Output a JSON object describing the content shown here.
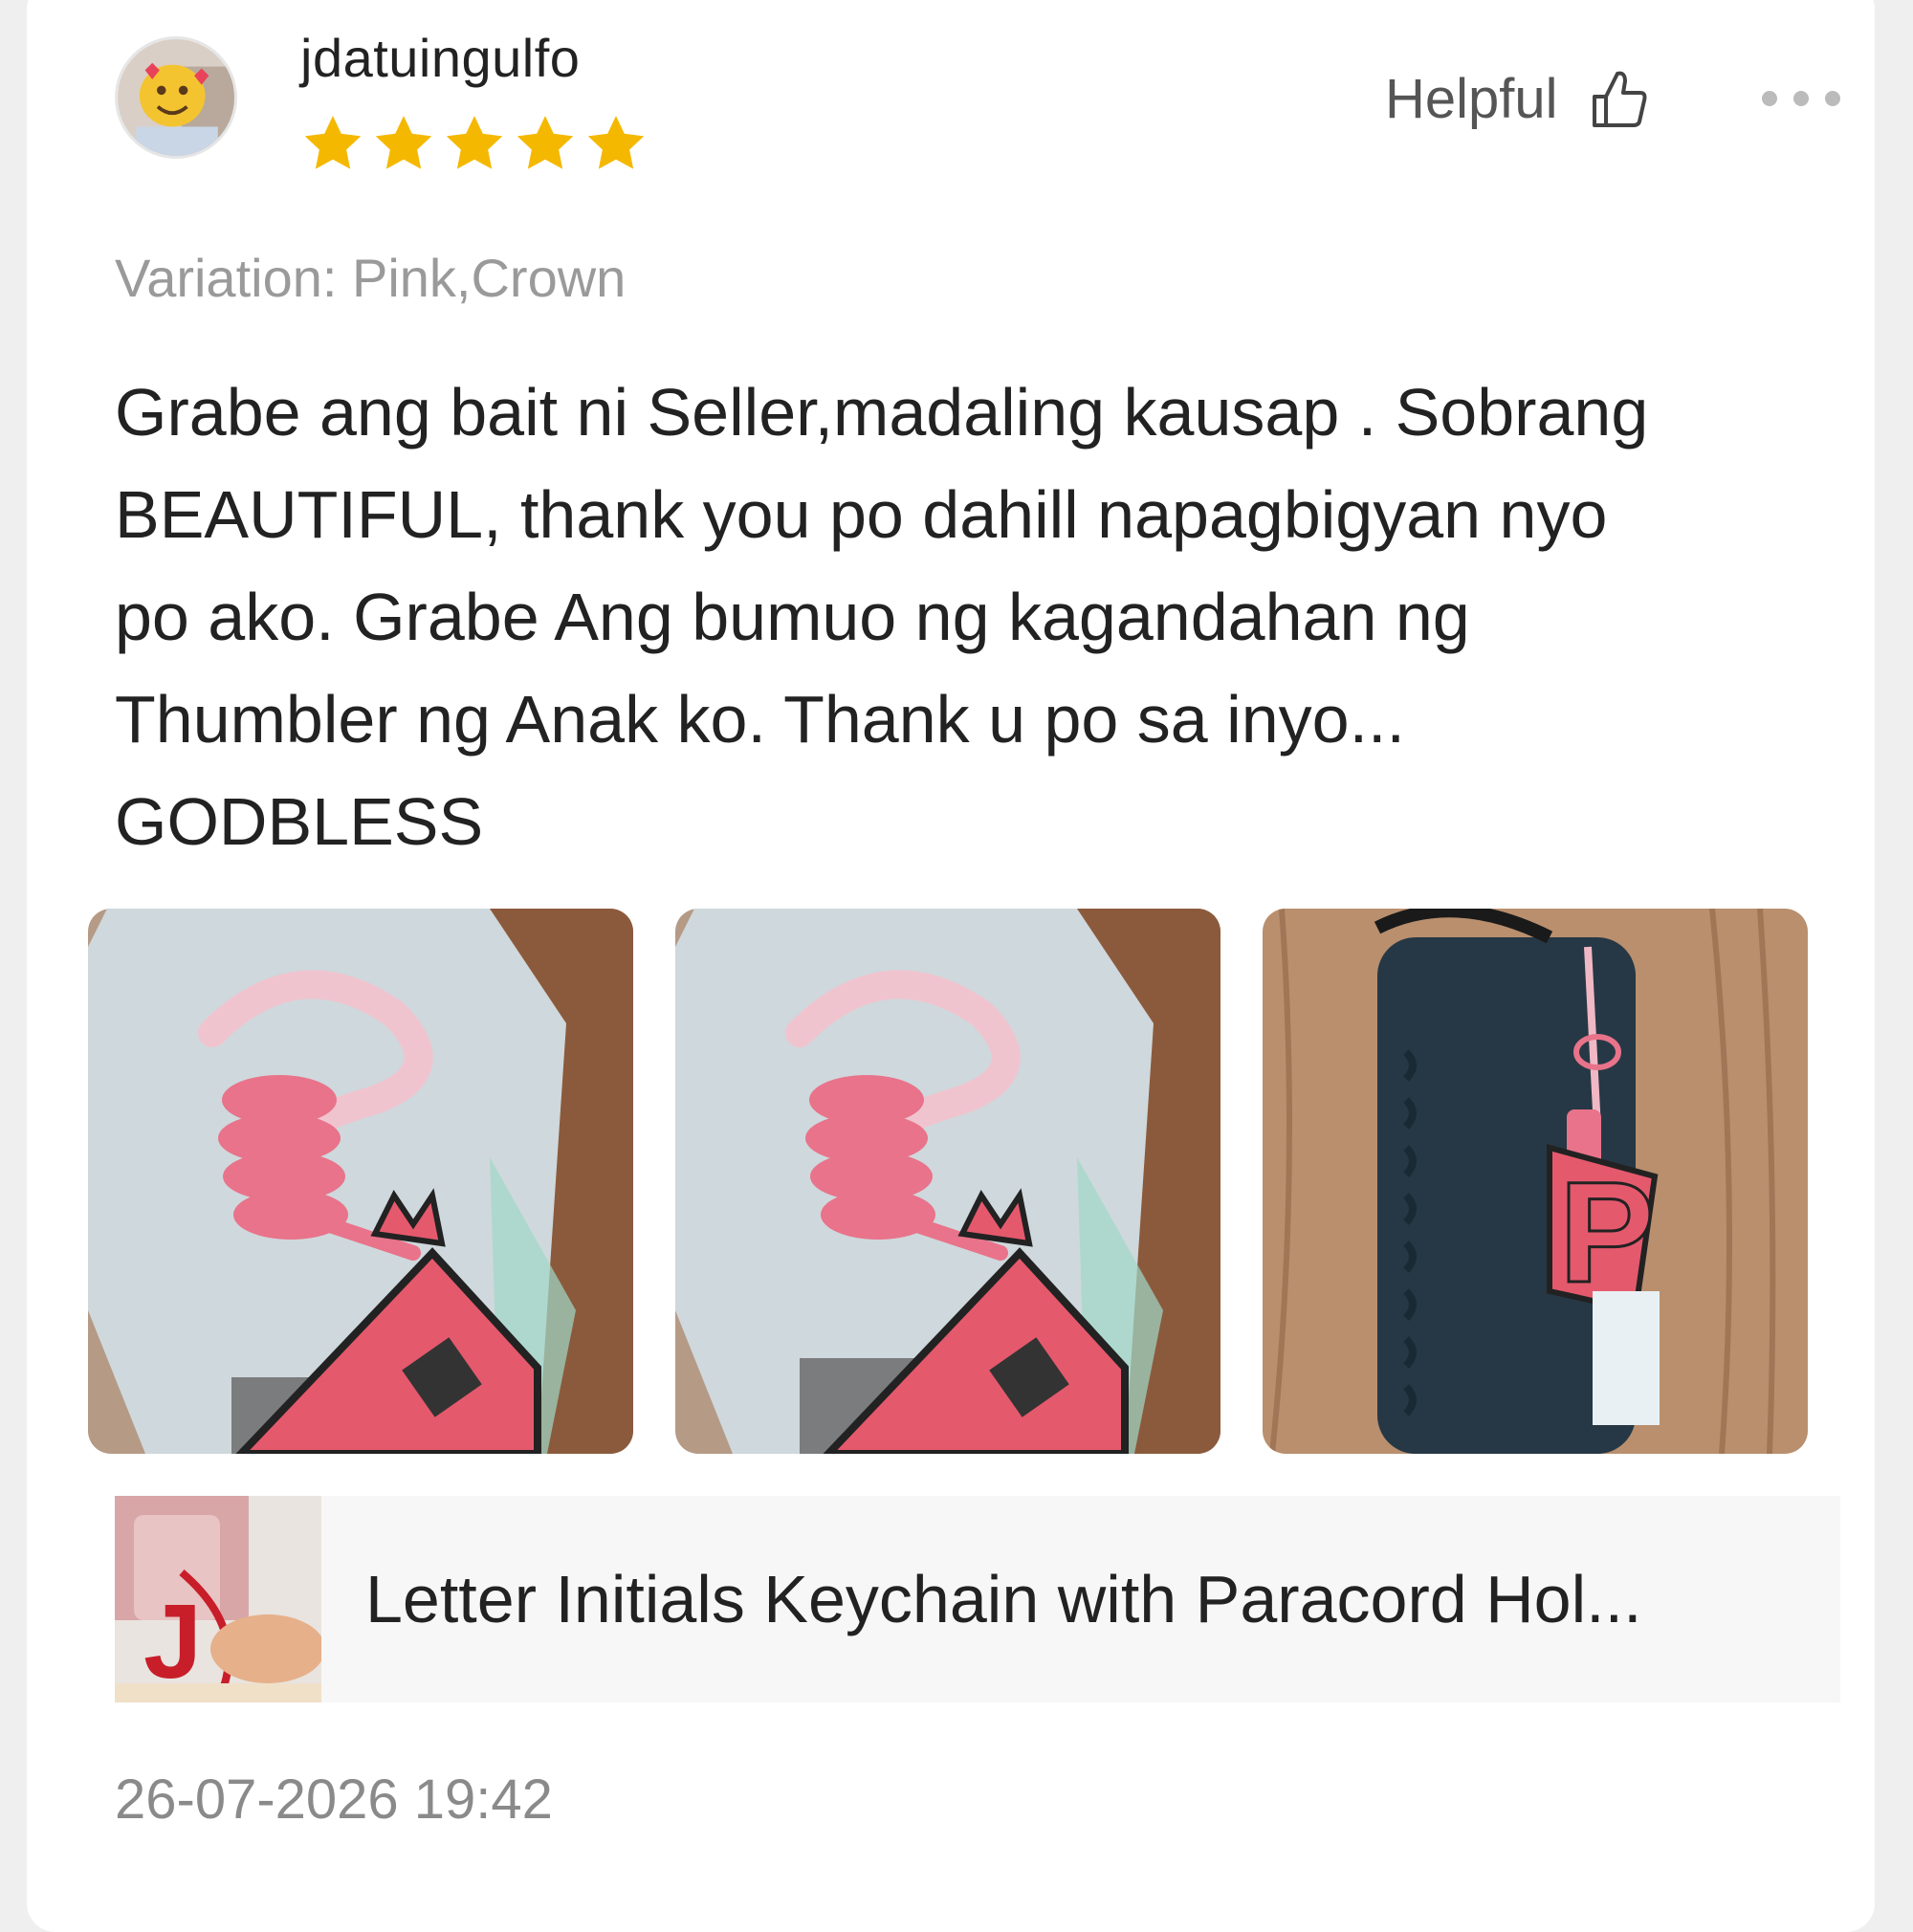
{
  "review": {
    "username": "jdatuingulfo",
    "rating": 5,
    "rating_max": 5,
    "star_color": "#F5B800",
    "helpful_label": "Helpful",
    "variation": "Variation: Pink,Crown",
    "body_lines": [
      "Grabe ang bait ni Seller,madaling kausap . Sobrang",
      "BEAUTIFUL, thank you po dahill napagbigyan nyo",
      "po ako. Grabe Ang bumuo ng kagandahan ng",
      "Thumbler ng Anak ko. Thank u po sa inyo...",
      "GODBLESS"
    ],
    "photos": [
      "keychain-package-photo",
      "keychain-package-photo",
      "keychain-on-tumbler-photo"
    ],
    "product": {
      "name": "Letter Initials Keychain with Paracord Hol..."
    },
    "timestamp": "26-07-2026 19:42"
  },
  "icons": {
    "thumb": "thumbs-up-icon",
    "more": "more-dots-icon",
    "star": "star-icon"
  }
}
